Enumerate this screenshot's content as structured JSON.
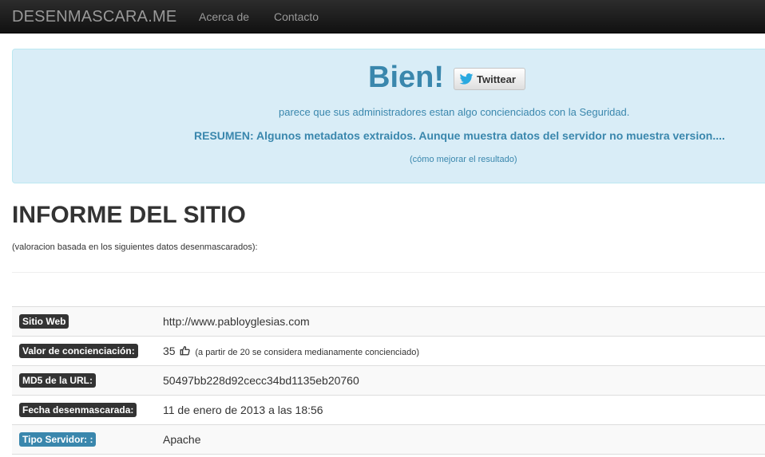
{
  "navbar": {
    "brand": "DESENMASCARA.ME",
    "links": [
      "Acerca de",
      "Contacto"
    ]
  },
  "hero": {
    "title": "Bien!",
    "tweet_label": "Twittear",
    "text": "parece que sus administradores estan algo concienciados con la Seguridad.",
    "summary": "RESUMEN: Algunos metadatos extraidos. Aunque muestra datos del servidor no muestra version....",
    "improve_link": "(cómo mejorar el resultado)"
  },
  "report": {
    "title": "INFORME DEL SITIO",
    "subtitle": "(valoracion basada en los siguientes datos desenmascarados):",
    "rows": [
      {
        "label": "Sitio Web",
        "value": "http://www.pabloyglesias.com"
      },
      {
        "label": "Valor de concienciación:",
        "value": "35",
        "note": "(a partir de 20 se considera medianamente concienciado)"
      },
      {
        "label": "MD5 de la URL:",
        "value": "50497bb228d92cecc34bd1135eb20760"
      },
      {
        "label": "Fecha desenmascarada:",
        "value": "11 de enero de 2013 a las 18:56"
      },
      {
        "label": "Tipo Servidor: :",
        "value": "Apache"
      }
    ]
  },
  "colors": {
    "navbar_bg": "#1b1b1b",
    "hero_bg": "#d9edf7",
    "hero_text": "#3a87ad",
    "label_dark": "#333333",
    "label_info": "#3a87ad"
  },
  "icons": [
    "twitter-bird-icon",
    "thumbs-up-icon"
  ]
}
